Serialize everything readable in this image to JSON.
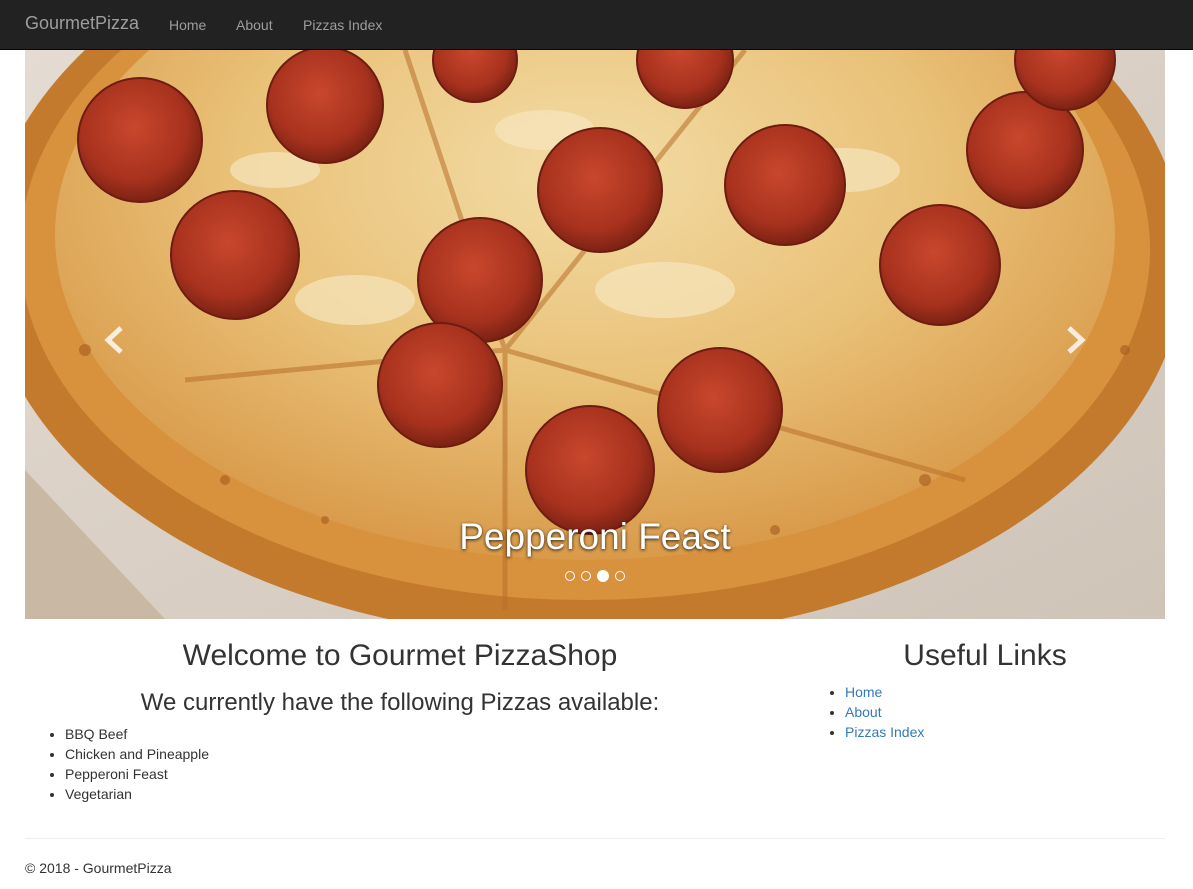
{
  "nav": {
    "brand": "GourmetPizza",
    "links": [
      "Home",
      "About",
      "Pizzas Index"
    ]
  },
  "carousel": {
    "caption": "Pepperoni Feast",
    "slide_count": 4,
    "active_index": 2,
    "prev_icon": "chevron-left-icon",
    "next_icon": "chevron-right-icon"
  },
  "main": {
    "title": "Welcome to Gourmet PizzaShop",
    "subtitle": "We currently have the following Pizzas available:",
    "pizzas": [
      "BBQ Beef",
      "Chicken and Pineapple",
      "Pepperoni Feast",
      "Vegetarian"
    ]
  },
  "sidebar": {
    "title": "Useful Links",
    "links": [
      "Home",
      "About",
      "Pizzas Index"
    ]
  },
  "footer": {
    "text": "© 2018 - GourmetPizza"
  },
  "colors": {
    "navbar_bg": "#222222",
    "nav_text": "#9d9d9d",
    "link": "#337ab7"
  }
}
